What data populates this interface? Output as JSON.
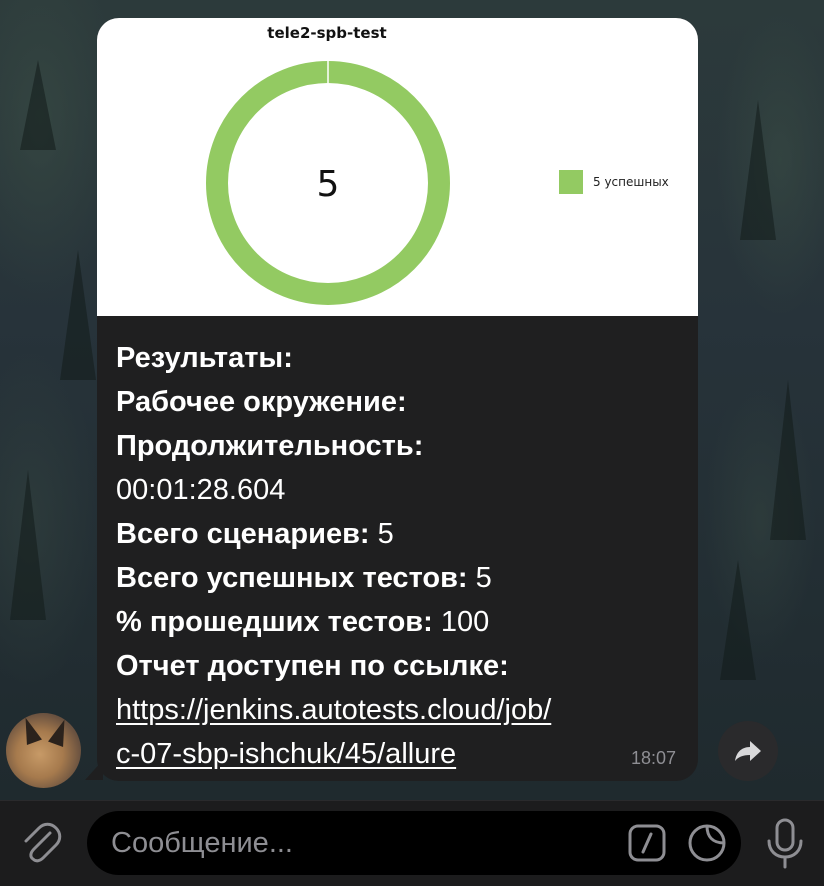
{
  "chart_data": {
    "type": "pie",
    "title": "tele2-spb-test",
    "center_label": "5",
    "slices": [
      {
        "name": "5 успешных",
        "value": 5,
        "color": "#93ca62"
      }
    ],
    "legend": {
      "position": "right",
      "entries": [
        "5 успешных"
      ]
    }
  },
  "message": {
    "results_label": "Результаты:",
    "environment_label": "Рабочее окружение:",
    "duration_label": "Продолжительность:",
    "duration_value": "00:01:28.604",
    "scenarios_label": "Всего сценариев:",
    "scenarios_value": "5",
    "passed_label": "Всего успешных тестов:",
    "passed_value": "5",
    "percent_label": "% прошедших тестов:",
    "percent_value": "100",
    "report_label": "Отчет доступен по ссылке:",
    "link_line1": "https://jenkins.autotests.cloud/job/",
    "link_line2": "c-07-sbp-ishchuk/45/allure",
    "time": "18:07"
  },
  "composer": {
    "placeholder": "Сообщение..."
  },
  "icons": {
    "attach": "paperclip-icon",
    "command": "slash-command-icon",
    "sticker": "sticker-icon",
    "mic": "microphone-icon",
    "forward": "forward-arrow-icon"
  }
}
